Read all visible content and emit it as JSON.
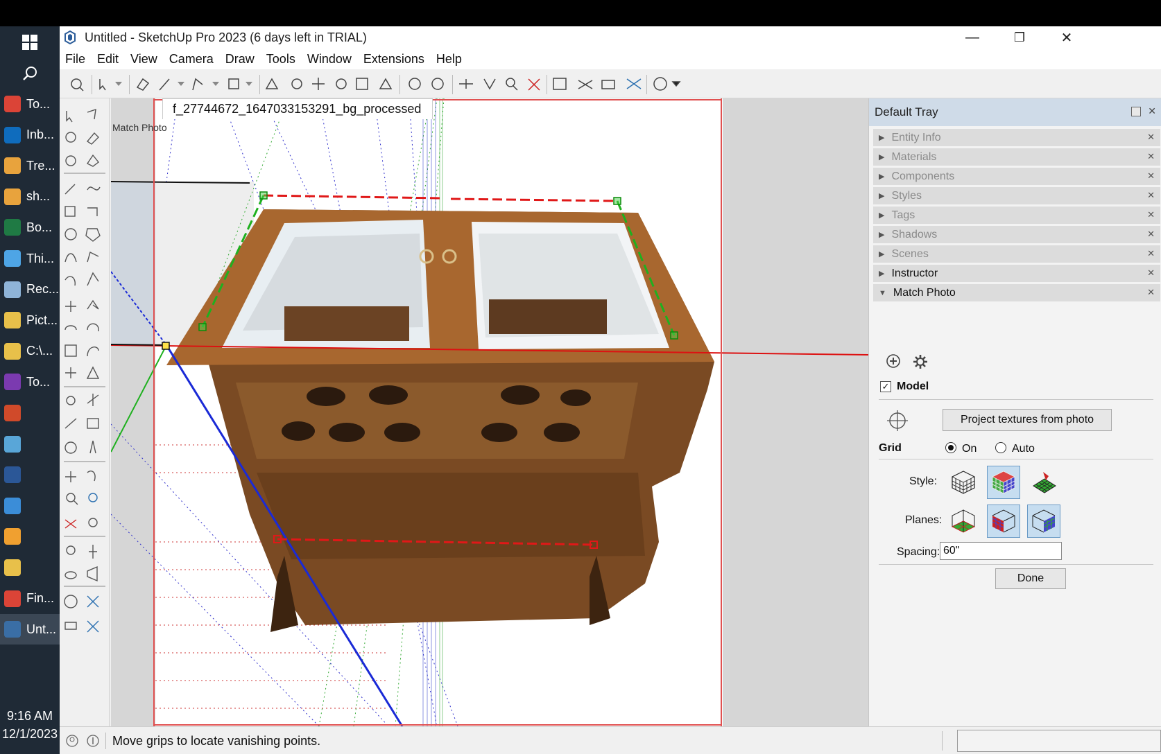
{
  "taskbar": {
    "items": [
      {
        "label": "To...",
        "icon": "chrome-icon",
        "color": "#db4437"
      },
      {
        "label": "Inb...",
        "icon": "outlook-icon",
        "color": "#0f6cbd"
      },
      {
        "label": "Tre...",
        "icon": "mail-icon",
        "color": "#e8a33d"
      },
      {
        "label": "sh...",
        "icon": "mail-icon",
        "color": "#e8a33d"
      },
      {
        "label": "Bo...",
        "icon": "excel-icon",
        "color": "#1f7a44"
      },
      {
        "label": "Thi...",
        "icon": "this-pc-icon",
        "color": "#4ea5e6"
      },
      {
        "label": "Rec...",
        "icon": "recycle-bin-icon",
        "color": "#8fb4d8"
      },
      {
        "label": "Pict...",
        "icon": "folder-icon",
        "color": "#e8c04a"
      },
      {
        "label": "C:\\...",
        "icon": "folder-icon",
        "color": "#e8c04a"
      },
      {
        "label": "To...",
        "icon": "onenote-icon",
        "color": "#7b3ab0"
      },
      {
        "label": "",
        "icon": "powerpoint-icon",
        "color": "#d04a2a"
      },
      {
        "label": "",
        "icon": "paint-icon",
        "color": "#59a6d8"
      },
      {
        "label": "",
        "icon": "word-icon",
        "color": "#2b5797"
      },
      {
        "label": "",
        "icon": "monitor-icon",
        "color": "#3b8dd8"
      },
      {
        "label": "",
        "icon": "app-f-icon",
        "color": "#f0a030"
      },
      {
        "label": "",
        "icon": "pencil-icon",
        "color": "#e8c04a"
      },
      {
        "label": "Fin...",
        "icon": "chrome-icon",
        "color": "#db4437"
      },
      {
        "label": "Unt...",
        "icon": "sketchup-icon",
        "color": "#3a6ea5"
      }
    ],
    "time": "9:16 AM",
    "date": "12/1/2023"
  },
  "window": {
    "title": "Untitled - SketchUp Pro 2023 (6 days left in TRIAL)",
    "minimize": "—",
    "maximize": "❐",
    "close": "✕"
  },
  "menu": [
    "File",
    "Edit",
    "View",
    "Camera",
    "Draw",
    "Tools",
    "Window",
    "Extensions",
    "Help"
  ],
  "viewport": {
    "tab": "f_27744672_1647033153291_bg_processed",
    "mode_label": "Match Photo"
  },
  "tray": {
    "title": "Default Tray",
    "panels": [
      {
        "label": "Entity Info",
        "open": false,
        "active": false
      },
      {
        "label": "Materials",
        "open": false,
        "active": false
      },
      {
        "label": "Components",
        "open": false,
        "active": false
      },
      {
        "label": "Styles",
        "open": false,
        "active": false
      },
      {
        "label": "Tags",
        "open": false,
        "active": false
      },
      {
        "label": "Shadows",
        "open": false,
        "active": false
      },
      {
        "label": "Scenes",
        "open": false,
        "active": false
      },
      {
        "label": "Instructor",
        "open": false,
        "active": true
      },
      {
        "label": "Match Photo",
        "open": true,
        "active": true
      }
    ],
    "match_photo": {
      "model_label": "Model",
      "model_checked": true,
      "project_button": "Project textures from photo",
      "grid_label": "Grid",
      "grid_on": "On",
      "grid_auto": "Auto",
      "grid_selected": "On",
      "style_label": "Style:",
      "planes_label": "Planes:",
      "spacing_label": "Spacing:",
      "spacing_value": "60\"",
      "done_button": "Done"
    }
  },
  "status": {
    "message": "Move grips to locate vanishing points."
  }
}
